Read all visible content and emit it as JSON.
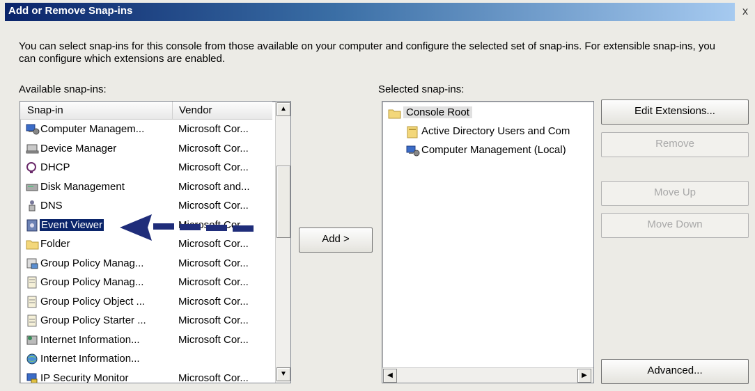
{
  "window": {
    "title": "Add or Remove Snap-ins",
    "close_label": "x"
  },
  "description": "You can select snap-ins for this console from those available on your computer and configure the selected set of snap-ins. For extensible snap-ins, you can configure which extensions are enabled.",
  "available": {
    "label": "Available snap-ins:",
    "columns": [
      "Snap-in",
      "Vendor"
    ],
    "items": [
      {
        "name": "Computer Managem...",
        "vendor": "Microsoft Cor...",
        "icon": "computer-management-icon"
      },
      {
        "name": "Device Manager",
        "vendor": "Microsoft Cor...",
        "icon": "device-manager-icon"
      },
      {
        "name": "DHCP",
        "vendor": "Microsoft Cor...",
        "icon": "dhcp-icon"
      },
      {
        "name": "Disk Management",
        "vendor": "Microsoft and...",
        "icon": "disk-management-icon"
      },
      {
        "name": "DNS",
        "vendor": "Microsoft Cor...",
        "icon": "dns-icon"
      },
      {
        "name": "Event Viewer",
        "vendor": "Microsoft Cor...",
        "icon": "event-viewer-icon",
        "selected": true
      },
      {
        "name": "Folder",
        "vendor": "Microsoft Cor...",
        "icon": "folder-icon"
      },
      {
        "name": "Group Policy Manag...",
        "vendor": "Microsoft Cor...",
        "icon": "group-policy-management-icon"
      },
      {
        "name": "Group Policy Manag...",
        "vendor": "Microsoft Cor...",
        "icon": "group-policy-editor-icon"
      },
      {
        "name": "Group Policy Object ...",
        "vendor": "Microsoft Cor...",
        "icon": "group-policy-object-icon"
      },
      {
        "name": "Group Policy Starter ...",
        "vendor": "Microsoft Cor...",
        "icon": "group-policy-starter-icon"
      },
      {
        "name": "Internet Information...",
        "vendor": "Microsoft Cor...",
        "icon": "iis-icon"
      },
      {
        "name": "Internet Information...",
        "vendor": "",
        "icon": "iis-globe-icon"
      },
      {
        "name": "IP Security Monitor",
        "vendor": "Microsoft Cor...",
        "icon": "ip-security-icon"
      }
    ]
  },
  "add_button": "Add >",
  "selected": {
    "label": "Selected snap-ins:",
    "items": [
      {
        "name": "Console Root",
        "level": 0,
        "icon": "folder-icon",
        "highlight": true
      },
      {
        "name": "Active Directory Users and Com",
        "level": 1,
        "icon": "active-directory-icon"
      },
      {
        "name": "Computer Management (Local)",
        "level": 1,
        "icon": "computer-management-icon"
      }
    ]
  },
  "buttons": {
    "edit_extensions": "Edit Extensions...",
    "remove": "Remove",
    "move_up": "Move Up",
    "move_down": "Move Down",
    "advanced": "Advanced..."
  }
}
